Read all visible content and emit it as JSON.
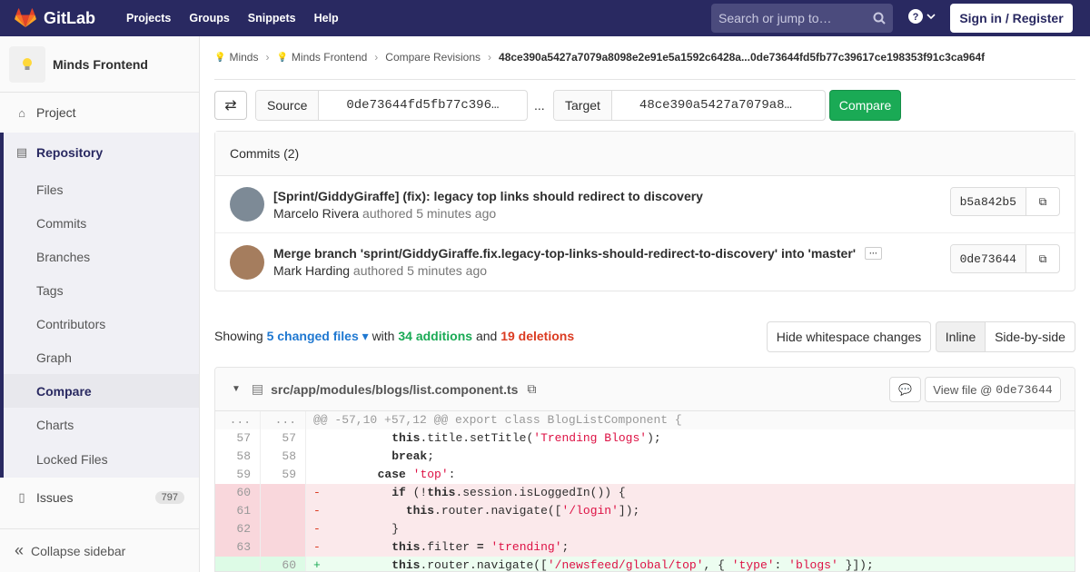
{
  "brand": {
    "name": "GitLab"
  },
  "topnav": {
    "links": [
      "Projects",
      "Groups",
      "Snippets",
      "Help"
    ],
    "search_placeholder": "Search or jump to…",
    "signin": "Sign in / Register"
  },
  "sidebar": {
    "project_name": "Minds Frontend",
    "project": "Project",
    "repository": "Repository",
    "repo_items": [
      "Files",
      "Commits",
      "Branches",
      "Tags",
      "Contributors",
      "Graph",
      "Compare",
      "Charts",
      "Locked Files"
    ],
    "issues": "Issues",
    "issues_count": "797",
    "collapse": "Collapse sidebar"
  },
  "breadcrumb": [
    "Minds",
    "Minds Frontend",
    "Compare Revisions",
    "48ce390a5427a7079a8098e2e91e5a1592c6428a...0de73644fd5fb77c39617ce198353f91c3ca964f"
  ],
  "compare": {
    "source_label": "Source",
    "source_value": "0de73644fd5fb77c396…",
    "target_label": "Target",
    "target_value": "48ce390a5427a7079a8…",
    "dots": "...",
    "button": "Compare"
  },
  "commits": {
    "header": "Commits (2)",
    "items": [
      {
        "title": "[Sprint/GiddyGiraffe] (fix): legacy top links should redirect to discovery",
        "author": "Marcelo Rivera",
        "authored": "authored",
        "time": "5 minutes ago",
        "sha": "b5a842b5"
      },
      {
        "title": "Merge branch 'sprint/GiddyGiraffe.fix.legacy-top-links-should-redirect-to-discovery' into 'master'",
        "author": "Mark Harding",
        "authored": "authored",
        "time": "5 minutes ago",
        "sha": "0de73644"
      }
    ]
  },
  "summary": {
    "showing": "Showing",
    "files": "5 changed files",
    "with": "with",
    "additions": "34 additions",
    "and": "and",
    "deletions": "19 deletions"
  },
  "view_buttons": {
    "whitespace": "Hide whitespace changes",
    "inline": "Inline",
    "side": "Side-by-side"
  },
  "file": {
    "path": "src/app/modules/blogs/list.component.ts",
    "view_file": "View file @",
    "view_sha": "0de73644"
  },
  "diff": {
    "hunk_old": "...",
    "hunk_new": "...",
    "hunk": "@@ -57,10 +57,12 @@ export class BlogListComponent {"
  }
}
